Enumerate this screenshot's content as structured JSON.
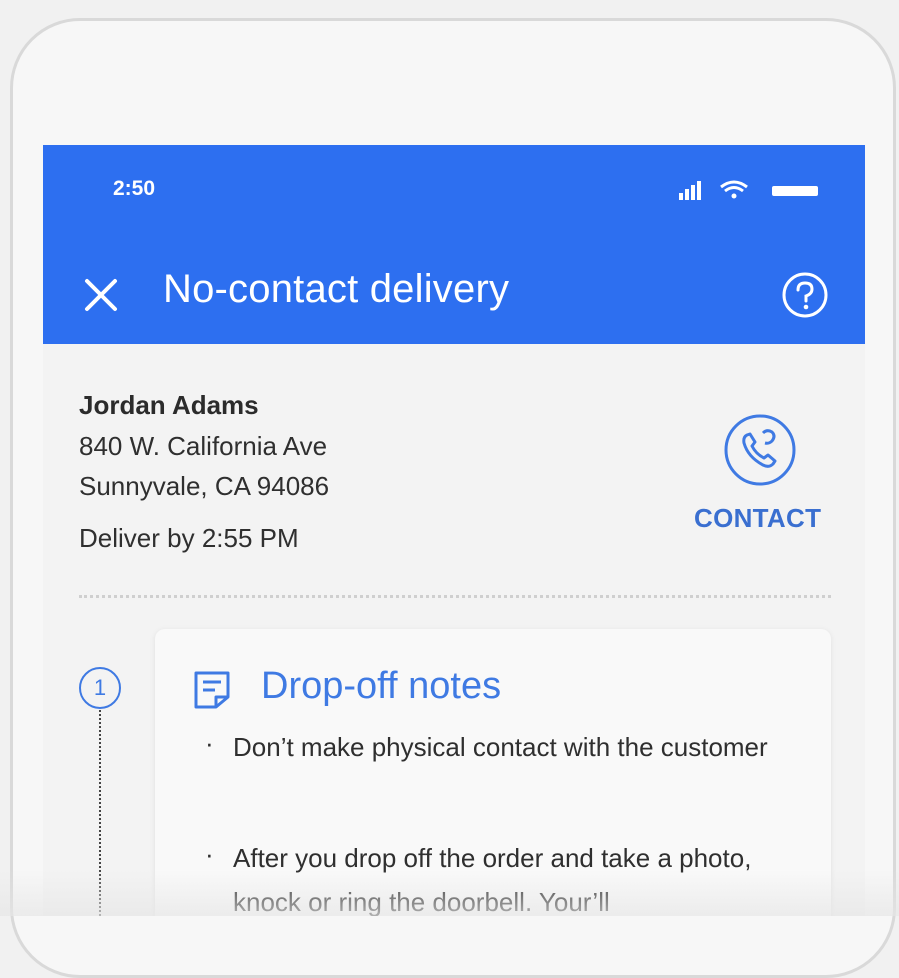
{
  "status_bar": {
    "time": "2:50"
  },
  "app_bar": {
    "title": "No-contact delivery"
  },
  "customer": {
    "name": "Jordan Adams",
    "address_line1": "840 W. California Ave",
    "address_line2": "Sunnyvale, CA 94086",
    "deliver_by": "Deliver by 2:55 PM",
    "contact_label": "CONTACT"
  },
  "steps": [
    {
      "number": "1",
      "title": "Drop-off notes",
      "items": [
        "Don’t make physical contact with the customer",
        "After you drop off the order and take a photo, knock or ring the doorbell. Your’ll"
      ]
    }
  ],
  "colors": {
    "accent": "#2d6ff0",
    "accent_text": "#3f7ae3",
    "background": "#f3f3f3"
  },
  "icons": [
    "close-icon",
    "help-icon",
    "phone-contact-icon",
    "notes-icon",
    "signal-icon",
    "wifi-icon",
    "battery-icon"
  ]
}
